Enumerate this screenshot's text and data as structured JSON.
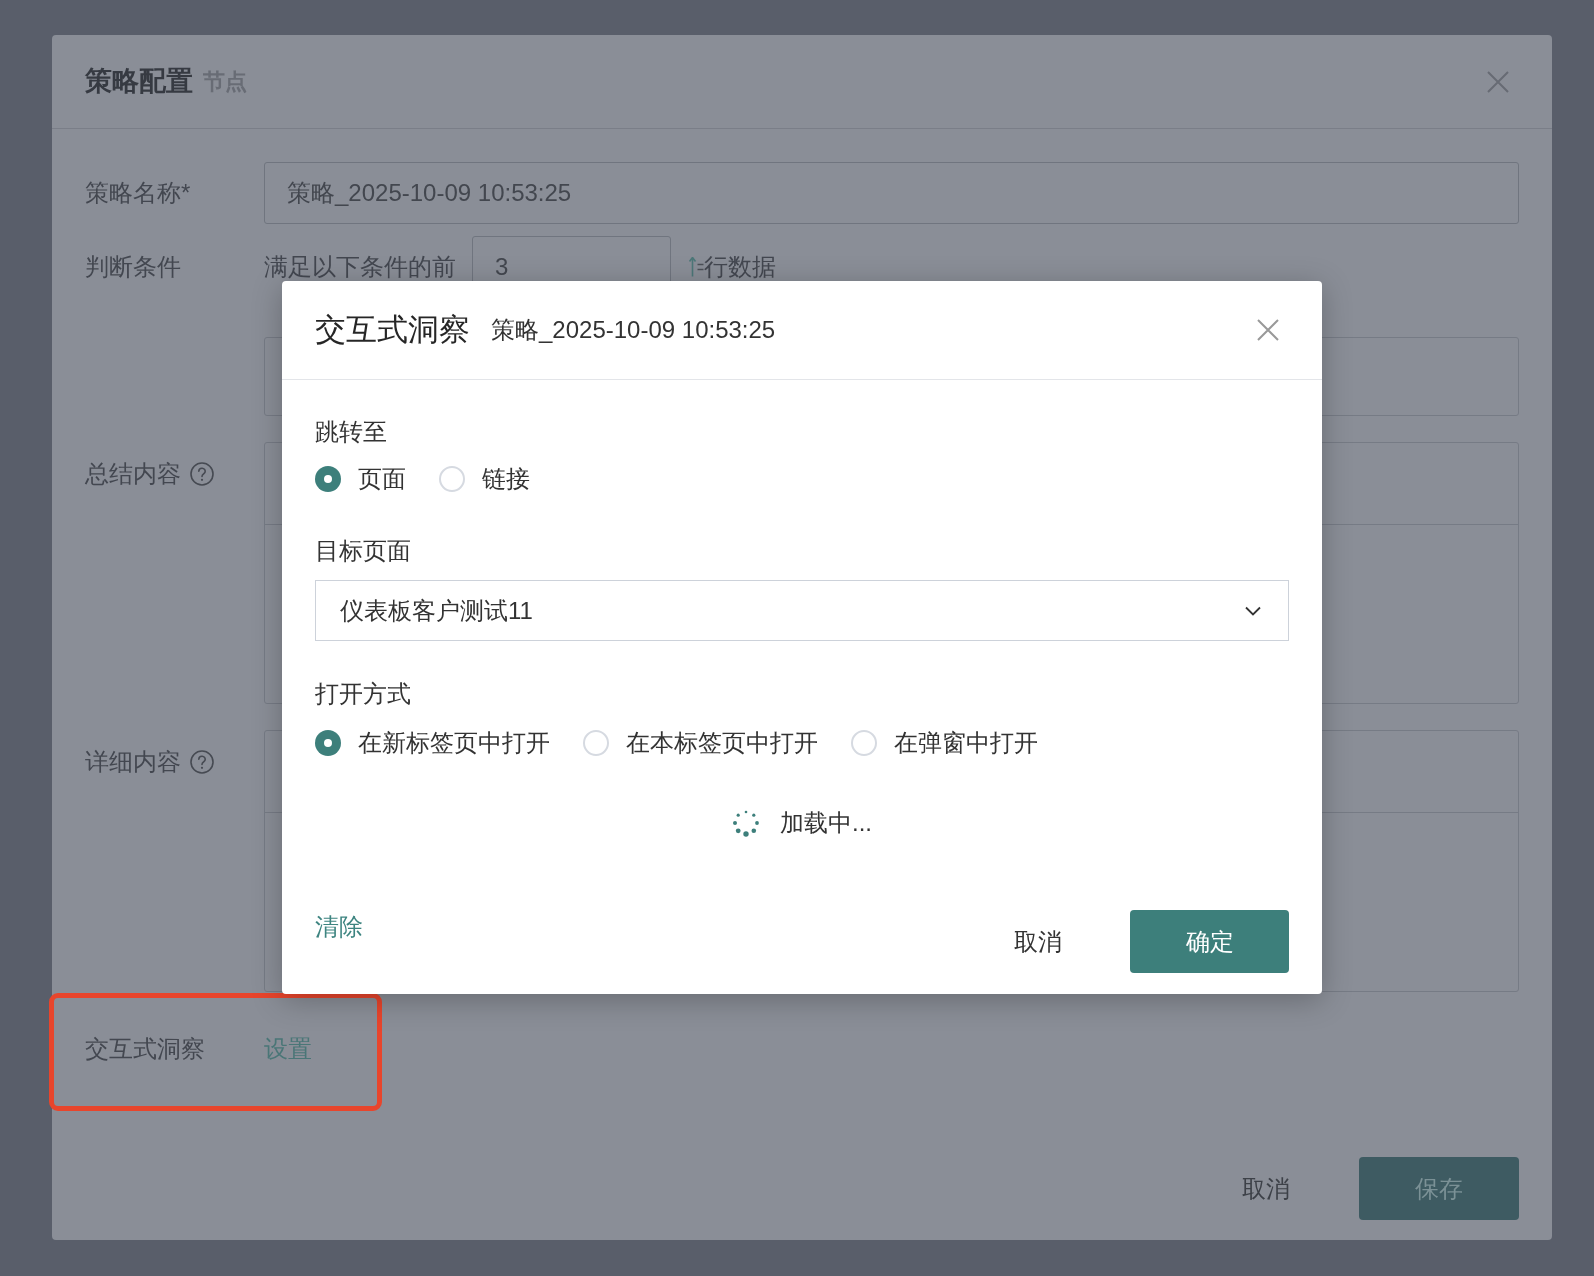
{
  "strategy_dialog": {
    "title": "策略配置",
    "subtitle": "节点",
    "rows": [
      {
        "kind": "input",
        "label": "策略名称*",
        "value": "策略_2025-10-09 10:53:25",
        "highlighted": false
      },
      {
        "kind": "condition",
        "label": "判断条件",
        "prefix": "满足以下条件的前",
        "value": "3",
        "suffix": "行数据",
        "highlighted": false
      },
      {
        "kind": "panel",
        "highlighted": false
      },
      {
        "kind": "editor",
        "label": "总结内容",
        "help": true,
        "highlighted": false
      },
      {
        "kind": "editor",
        "label": "详细内容",
        "help": true,
        "highlighted": false
      },
      {
        "kind": "link",
        "label": "交互式洞察",
        "link": "设置",
        "highlighted": true
      }
    ],
    "buttons": [
      {
        "kind": "secondary",
        "label": "取消"
      },
      {
        "kind": "primary",
        "label": "保存"
      }
    ]
  },
  "insight_modal": {
    "title": "交互式洞察",
    "subtitle": "策略_2025-10-09 10:53:25",
    "sections": [
      {
        "kind": "radio",
        "label": "跳转至",
        "options": [
          {
            "label": "页面",
            "selected": true
          },
          {
            "label": "链接",
            "selected": false
          }
        ]
      },
      {
        "kind": "select",
        "label": "目标页面",
        "value": "仪表板客户测试11"
      },
      {
        "kind": "radio",
        "label": "打开方式",
        "options": [
          {
            "label": "在新标签页中打开",
            "selected": true
          },
          {
            "label": "在本标签页中打开",
            "selected": false
          },
          {
            "label": "在弹窗中打开",
            "selected": false
          }
        ]
      }
    ],
    "loading_text": "加载中...",
    "clear_link": "清除",
    "buttons": [
      {
        "kind": "secondary",
        "label": "取消"
      },
      {
        "kind": "primary",
        "label": "确定"
      }
    ]
  }
}
